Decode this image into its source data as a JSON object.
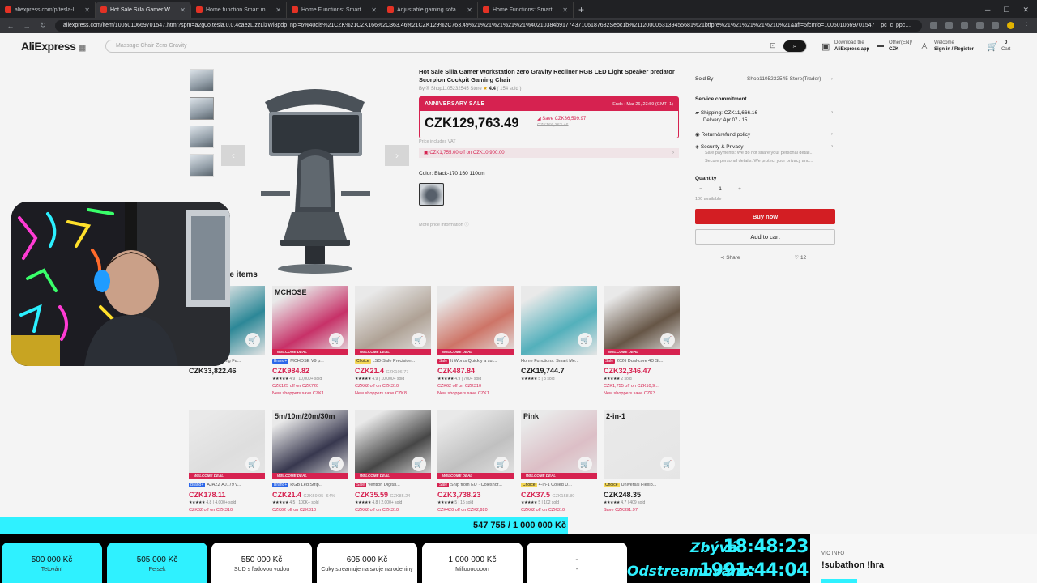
{
  "browser": {
    "tabs": [
      {
        "title": "aliexpress.com/p/tesla-landing/",
        "active": false
      },
      {
        "title": "Hot Sale Silla Gamer Workstation",
        "active": true
      },
      {
        "title": "Home function Smart memory",
        "active": false
      },
      {
        "title": "Home Functions: Smart Memo",
        "active": false
      },
      {
        "title": "Adjustable gaming sofa with h",
        "active": false
      },
      {
        "title": "Home Functions: Smart Memo",
        "active": false
      }
    ],
    "new_tab": "+",
    "url": "aliexpress.com/item/1005010669701547.html?spm=a2g0o.tesla.0.0.4caezLizzLizWi8pdp_npi=6%40dis%21CZK%21CZK166%2C363.46%21CZK129%2C763.49%21%21%21%21%21%40210384b9177437106187632Sebc1b%2112000053139455681%21btfpre%21%21%21%21%210%21&aff=5fcInfo=1005010669701547__pc_c_ppc_item_bridge_pc_s..."
  },
  "header": {
    "logo": "AliExpress",
    "search_placeholder": "Massage Chair Zero Gravity",
    "download_label": "Download the",
    "download_sub": "AliExpress app",
    "region_label": "Other(EN)/",
    "currency": "CZK",
    "welcome": "Welcome",
    "signin": "Sign in / Register",
    "cart_count": "0",
    "cart_label": "Cart"
  },
  "product": {
    "title": "Hot Sale Silla Gamer Workstation zero Gravity Recliner RGB LED Light Speaker predator Scorpion Cockpit Gaming Chair",
    "store_line": "By ® Shop1105232545 Store",
    "rating": "4.4",
    "sold": "( 154 sold )",
    "sale_label": "ANNIVERSARY SALE",
    "sale_ends": "Ends : Mar 26, 23:59 (GMT+1)",
    "price": "CZK129,763.49",
    "save": "Save CZK36,599.97",
    "original_price": "CZK166,363.46",
    "tax_note": "Price includes VAT",
    "coupon": "CZK1,755.00 off on CZK10,900.00",
    "color_label": "Color: Black-170 160 110cm",
    "more_info": "More price information"
  },
  "sidebar": {
    "sold_by_label": "Sold By",
    "sold_by_store": "Shop1105232545 Store(Trader)",
    "service_label": "Service commitment",
    "shipping": "Shipping: CZK11,666.16",
    "delivery": "Delivery: Apr 07 - 15",
    "refund": "Return&refund policy",
    "security": "Security & Privacy",
    "security_note1": "Safe payments: We do not share your personal detail...",
    "security_note2": "Secure personal details: We protect your privacy and...",
    "quantity_label": "Quantity",
    "quantity": "1",
    "qty_minus": "−",
    "qty_plus": "+",
    "available": "100 available",
    "buy_now": "Buy now",
    "add_to_cart": "Add to cart",
    "share": "Share",
    "likes": "12"
  },
  "more_items": {
    "title": "More to love items",
    "cards": [
      {
        "label": "",
        "badge": "",
        "name": "@HHome-Furnishing Fu...",
        "price": "CZK33,822.46",
        "orig": "",
        "rating": "",
        "offer": "",
        "offer2": "",
        "deal": "",
        "color": "#2f8e9e"
      },
      {
        "label": "MCHOSE",
        "badge": "Brand+",
        "name": "MCHOSE V9 p...",
        "price": "CZK984.82",
        "orig": "",
        "rating": "4.9 | 10,000+ sold",
        "offer": "CZK125 off on CZK720",
        "offer2": "New shoppers save CZK1...",
        "deal": "WELCOME DEAL",
        "color": "#d0346d"
      },
      {
        "label": "",
        "badge": "Choice",
        "name": "LSD-Safe Precision...",
        "price": "CZK21.4",
        "orig": "CZK106.77",
        "rating": "4.9 | 10,000+ sold",
        "offer": "CZK62 off on CZK310",
        "offer2": "New shoppers save CZK8...",
        "deal": "WELCOME DEAL",
        "color": "#b7a99c"
      },
      {
        "label": "",
        "badge": "Sale",
        "name": "It Works Quickly a sui...",
        "price": "CZK487.84",
        "orig": "",
        "rating": "4.9 | 700+ sold",
        "offer": "CZK62 off on CZK310",
        "offer2": "New shoppers save CZK1...",
        "deal": "WELCOME DEAL",
        "color": "#d77a6c"
      },
      {
        "label": "",
        "badge": "",
        "name": "Home Functions: Smart Me...",
        "price": "CZK19,744.7",
        "orig": "",
        "rating": "5 | 3 sold",
        "offer": "",
        "offer2": "",
        "deal": "",
        "color": "#57b8c4"
      },
      {
        "label": "",
        "badge": "Sale",
        "name": "2026 Dual-core 4D SL...",
        "price": "CZK32,346.47",
        "orig": "",
        "rating": "2 sold",
        "offer": "CZK1,755 off on CZK10,9...",
        "offer2": "New shoppers save CZK3...",
        "deal": "WELCOME DEAL",
        "color": "#6b5a4a"
      },
      {
        "label": "",
        "badge": "Brand+",
        "name": "AJAZZ AJ179 v...",
        "price": "CZK178.11",
        "orig": "",
        "rating": "4.8 | 4,000+ sold",
        "offer": "CZK62 off on CZK310",
        "offer2": "",
        "deal": "WELCOME DEAL",
        "color": "#e9e9e9"
      },
      {
        "label": "5m/10m/20m/30m",
        "badge": "Brand+",
        "name": "RGB Led Strip...",
        "price": "CZK21.4",
        "orig": "CZK59.95 -64%",
        "rating": "4.5 | 100K+ sold",
        "offer": "CZK62 off on CZK310",
        "offer2": "",
        "deal": "WELCOME DEAL",
        "color": "#3a3a52"
      },
      {
        "label": "",
        "badge": "Sale",
        "name": "Vention Digital...",
        "price": "CZK35.59",
        "orig": "CZK85.24",
        "rating": "4.8 | 2,000+ sold",
        "offer": "CZK62 off on CZK310",
        "offer2": "",
        "deal": "WELCOME DEAL",
        "color": "#4a4a4a"
      },
      {
        "label": "",
        "badge": "Sale",
        "name": "Ship from EU · Coleshor...",
        "price": "CZK3,738.23",
        "orig": "",
        "rating": "5 | 15 sold",
        "offer": "CZK420 off on CZK2,920",
        "offer2": "",
        "deal": "WELCOME DEAL",
        "color": "#c9c9c9"
      },
      {
        "label": "Pink",
        "badge": "Choice",
        "name": "4-in-1 Coiled U...",
        "price": "CZK37.5",
        "orig": "CZK158.80",
        "rating": "5 | 102 sold",
        "offer": "CZK62 off on CZK310",
        "offer2": "",
        "deal": "WELCOME DEAL",
        "color": "#e6c7cf"
      },
      {
        "label": "2-in-1",
        "badge": "Choice",
        "name": "Universal Flexib...",
        "price": "CZK248.35",
        "orig": "",
        "rating": "4.7 | 409 sold",
        "offer": "Save CZK391.97",
        "offer2": "",
        "deal": "",
        "color": "#f2f2f2"
      }
    ]
  },
  "overlay": {
    "progress_text": "547 755 / 1 000 000 Kč",
    "progress_value": 0.547755,
    "goals": [
      {
        "amount": "500 000 Kč",
        "desc": "Tetování",
        "done": true
      },
      {
        "amount": "505 000 Kč",
        "desc": "Pejsek",
        "done": true
      },
      {
        "amount": "550 000 Kč",
        "desc": "SUD s ľadovou vodou",
        "done": false
      },
      {
        "amount": "605 000 Kč",
        "desc": "Cuky streamuje na svoje narodeniny",
        "done": false
      },
      {
        "amount": "1 000 000 Kč",
        "desc": "Miliooooooon",
        "done": false
      },
      {
        "amount": "-",
        "desc": "-",
        "done": false
      }
    ],
    "remaining_label": "Zbývá:",
    "remaining_value": "18:48:23",
    "streamed_label": "Odstreamováno:",
    "streamed_value": "1991:44:04",
    "info_label": "VÍC INFO",
    "info_text": "!subathon !hra"
  },
  "colors": {
    "accent": "#2ff1ff",
    "ali_red": "#e02454",
    "buy_red": "#dd2025"
  }
}
